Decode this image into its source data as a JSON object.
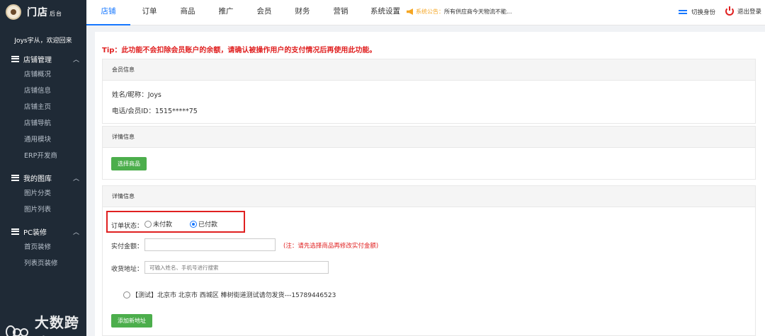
{
  "app": {
    "logo_text": "门店",
    "logo_sub": "后台"
  },
  "sidebar": {
    "welcome": "Joys宇从，欢迎回来",
    "groups": [
      {
        "title": "店铺管理",
        "items": [
          "店铺概况",
          "店铺信息",
          "店铺主页",
          "店铺导航",
          "通用模块",
          "ERP开发商"
        ]
      },
      {
        "title": "我的图库",
        "items": [
          "图片分类",
          "图片列表"
        ]
      },
      {
        "title": "PC装修",
        "items": [
          "首页装修",
          "列表页装修"
        ]
      }
    ]
  },
  "topnav": {
    "tabs": [
      "店铺",
      "订单",
      "商品",
      "推广",
      "会员",
      "财务",
      "营销",
      "系统设置"
    ],
    "active_index": 0,
    "notice_label": "系统公告：",
    "notice_text": "所有供应商今天物流不能...",
    "switch_role": "切换身份",
    "logout": "退出登录"
  },
  "main": {
    "tip": "Tip：此功能不会扣除会员账户的余额，请确认被操作用户的支付情况后再使用此功能。",
    "member_panel": {
      "title": "会员信息",
      "name_line": "姓名/昵称：Joys",
      "phone_line": "电话/会员ID：1515*****75"
    },
    "detail_panel": {
      "title": "详情信息",
      "select_button": "选择商品"
    },
    "detail_panel2": {
      "title": "详情信息",
      "order_status_label": "订单状态：",
      "radio_unpaid": "未付款",
      "radio_paid": "已付款",
      "selected": "已付款",
      "amount_label": "实付金额：",
      "amount_value": "",
      "amount_warn": "(注：请先选择商品再修改实付金额)",
      "address_label": "收货地址：",
      "address_placeholder": "可输入姓名、手机号进行搜索",
      "address_option": "【测试】北京市 北京市 西城区 棒树街道测试请勿发货---15789446523",
      "add_address_button": "添加新地址"
    }
  },
  "watermark": {
    "text": "大数跨境"
  },
  "colors": {
    "accent": "#1677ff",
    "danger": "#e02020",
    "success": "#4cae4c",
    "sidebar_bg": "#1f2a36",
    "notice": "#f5a623"
  }
}
